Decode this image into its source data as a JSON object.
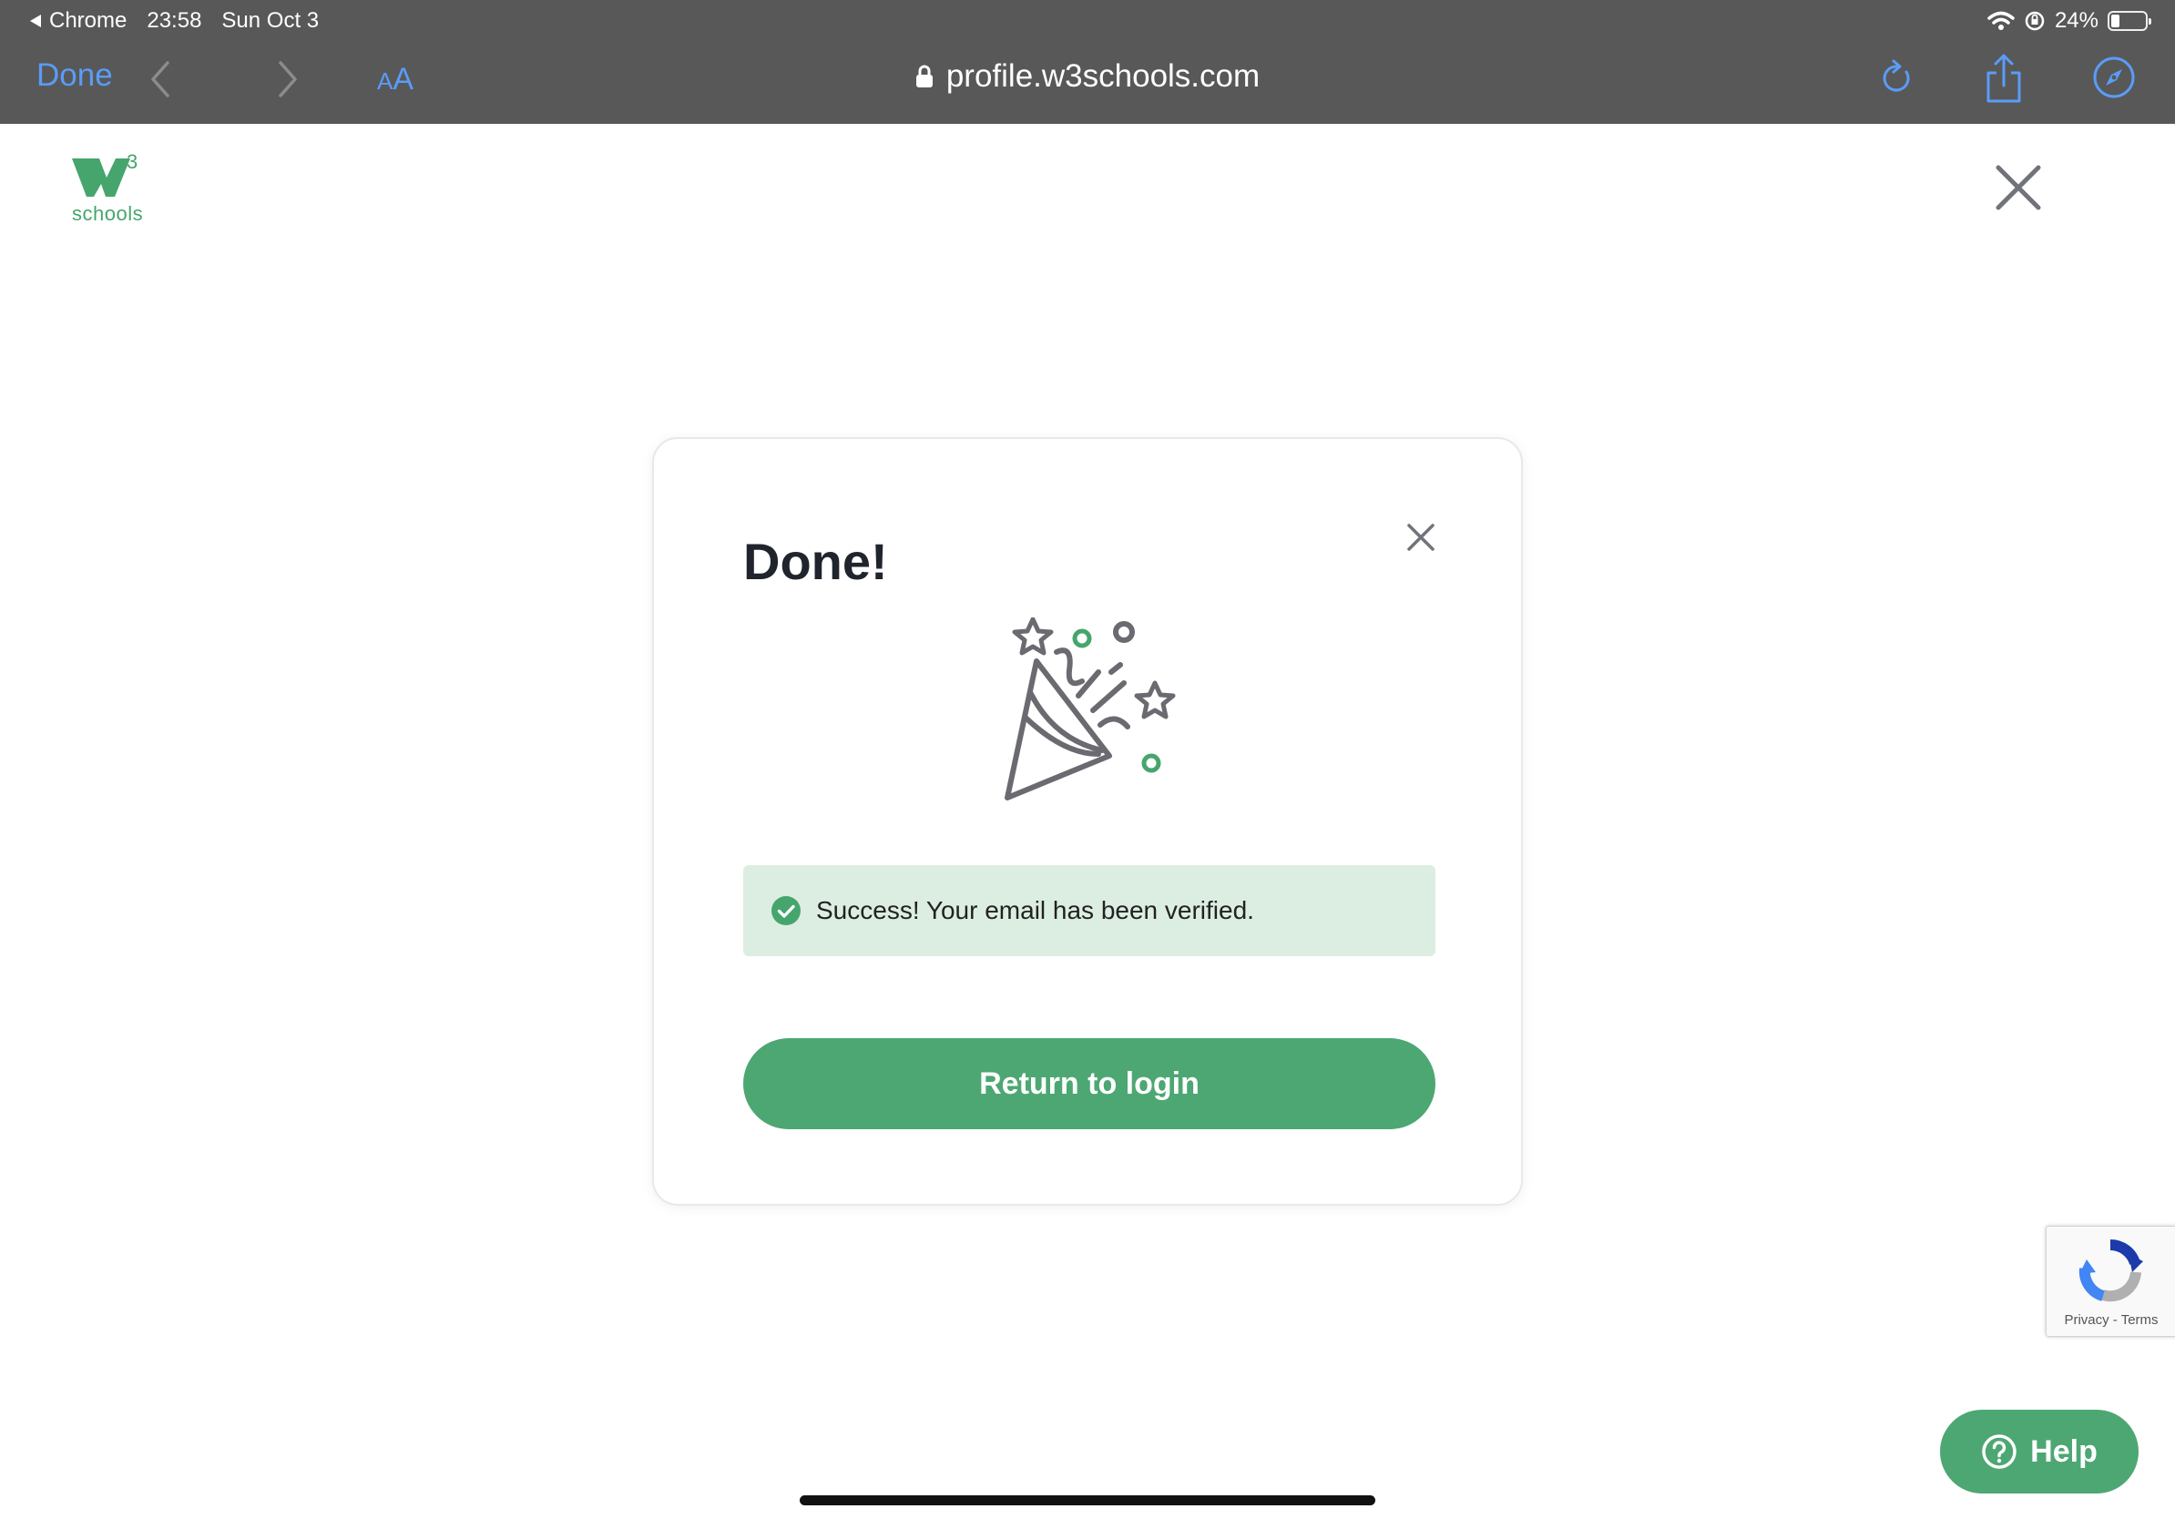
{
  "status_bar": {
    "back_app": "Chrome",
    "time": "23:58",
    "date": "Sun Oct 3",
    "battery_text": "24%",
    "battery_level": 0.24
  },
  "browser": {
    "done_label": "Done",
    "text_size_small": "A",
    "text_size_big": "A",
    "url": "profile.w3schools.com",
    "icons": [
      "back-icon",
      "forward-icon",
      "lock-icon",
      "reload-icon",
      "share-icon",
      "compass-icon"
    ]
  },
  "header": {
    "logo_superscript": "3",
    "logo_wordmark": "schools",
    "close_icon": "close-icon"
  },
  "dialog": {
    "title": "Done!",
    "illustration_icon": "party-popper-icon",
    "alert_message": "Success! Your email has been verified.",
    "alert_icon": "check-circle-icon",
    "button_label": "Return to login"
  },
  "recaptcha": {
    "privacy": "Privacy",
    "separator": "-",
    "terms": "Terms"
  },
  "help": {
    "label": "Help",
    "icon": "question-circle-icon"
  },
  "colors": {
    "brand_green": "#4da773",
    "logo_green": "#46a56c",
    "alert_background": "#dceee1",
    "chrome_gray": "#585858",
    "ios_blue": "#5a9cf7",
    "title_text": "#1f242d"
  }
}
